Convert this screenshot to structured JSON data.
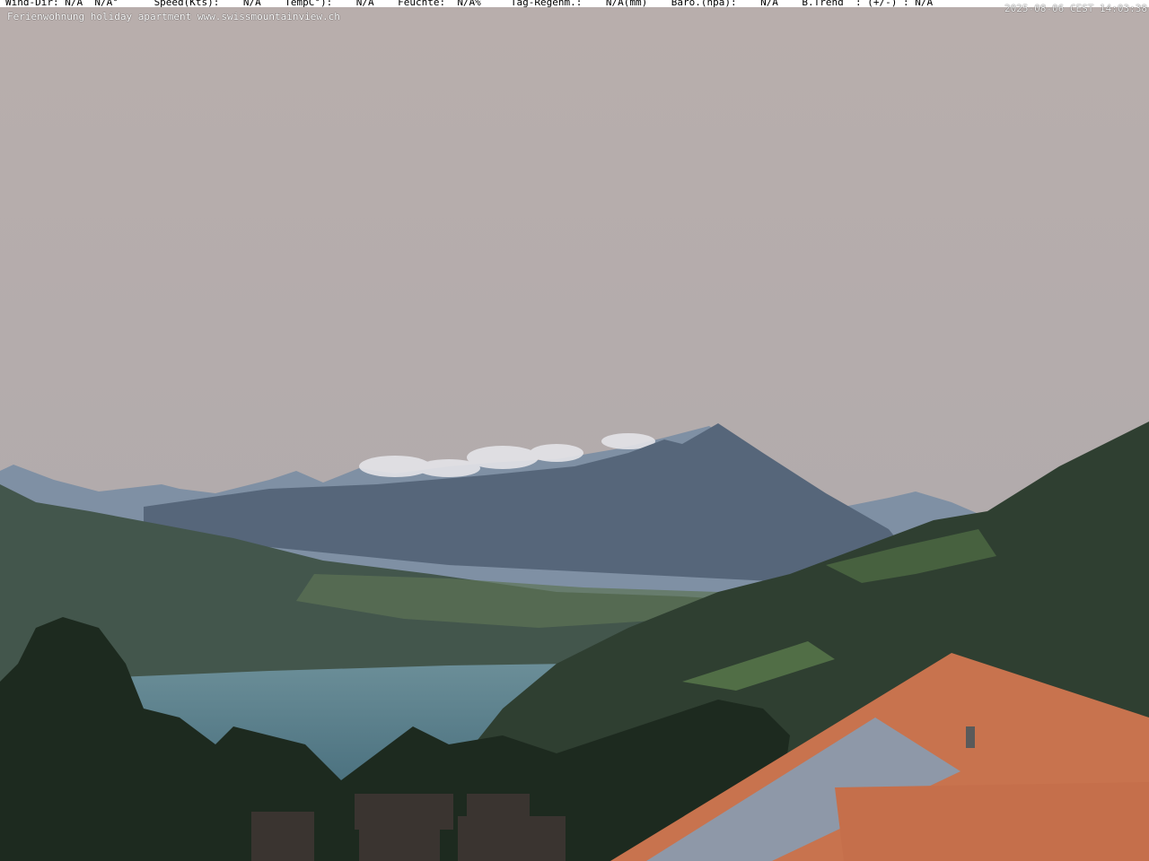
{
  "overlay": {
    "weather_line": "Wind-Dir: N/A  N/A°      Speed(Kts):    N/A    TempC°):    N/A    Feuchte:  N/A%     Tag-Regenm.:    N/A(mm)    Baro.(hpa):    N/A    B.Trend  : (+/-) : N/A",
    "timestamp": "2025-08-06 CEST 14:03:38",
    "caption": "Ferienwohnung holiday apartment www.swissmountainview.ch"
  },
  "colors": {
    "sky_top": "#b8aeac",
    "sky_bottom": "#aba9ad",
    "far_mountains": "#7d8ea2",
    "main_peak": "#4f5f72",
    "left_hill": "#3f5248",
    "lake": "#5a7f8c",
    "right_slope": "#2c3b2e",
    "roof_tiles": "#c8734e",
    "solar_panels": "#8c96a5"
  },
  "icons": [
    "webcam-scene"
  ]
}
